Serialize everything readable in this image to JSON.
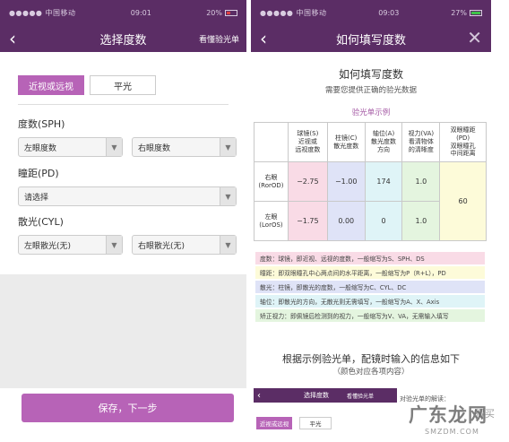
{
  "left": {
    "status": {
      "carrier": "●●●●● 中国移动 ",
      "time": "09:01",
      "battery": "20%"
    },
    "nav": {
      "back": "‹",
      "title": "选择度数",
      "right_link": "看懂验光单"
    },
    "type_tabs": [
      "近视或远视",
      "平光"
    ],
    "sph": {
      "label": "度数(SPH)",
      "right_eye_value": "左眼度数",
      "left_eye_value": "右眼度数"
    },
    "pd": {
      "label": "瞳距(PD)",
      "value": "请选择"
    },
    "cyl": {
      "label": "散光(CYL)",
      "first_value": "左眼散光(无)",
      "second_value": "右眼散光(无)"
    },
    "save_button": "保存，下一步"
  },
  "right": {
    "status": {
      "carrier": "●●●●● 中国移动 ",
      "time": "09:03",
      "battery": "27%"
    },
    "nav": {
      "back": "‹",
      "title": "如何填写度数",
      "close": "✕"
    },
    "heading": "如何填写度数",
    "subheading": "需要您提供正确的验光数据",
    "sample_label": "验光单示例",
    "table": {
      "headers": {
        "sph": "球镜(S)\n近视或\n远视度数",
        "cyl": "柱镜(C)\n散光度数",
        "axis": "轴位(A)\n散光度数\n方向",
        "va": "视力(VA)\n看清物体\n的清晰度",
        "pd": "双眼瞳距\n(PD)\n双眼瞳孔\n中间距离"
      },
      "rows": [
        {
          "eye": "右眼\n(RorOD)",
          "sph": "−2.75",
          "cyl": "−1.00",
          "axis": "174",
          "va": "1.0"
        },
        {
          "eye": "左眼\n(LorOS)",
          "sph": "−1.75",
          "cyl": "0.00",
          "axis": "0",
          "va": "1.0"
        }
      ],
      "pd_value": "60"
    },
    "legend": [
      {
        "text": "度数：球镜，即近视、远视的度数，一般缩写为S、SPH、DS",
        "color": "#f9dbe6"
      },
      {
        "text": "瞳距：即双眼瞳孔中心两点间的水平距离，一般缩写为P（R+L），PD",
        "color": "#fdfbd9"
      },
      {
        "text": "散光：柱镜，即散光的度数，一般缩写为C、CYL、DC",
        "color": "#dfe3f7"
      },
      {
        "text": "轴位：即散光的方向，无散光则无需填写，一般缩写为A、X、Axis",
        "color": "#dff4f7"
      },
      {
        "text": "矫正视力：即佩镜后检测到的视力，一般缩写为V、VA，无需输入填写",
        "color": "#e4f5df"
      }
    ],
    "footer_line1": "根据示例验光单，配镜时输入的信息如下",
    "footer_line2": "（颜色对应各项内容）",
    "mini": {
      "back": "‹",
      "title": "选择度数",
      "link": "看懂验光单",
      "explain": "对验光单的解读：",
      "tab_near": "近视或远视",
      "tab_plain": "平光"
    }
  },
  "watermark": {
    "main": "广东龙网",
    "side": "得买",
    "sub": "SMZDM.COM"
  }
}
